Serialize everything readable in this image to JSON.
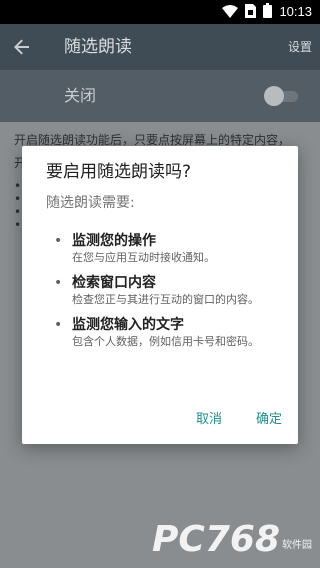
{
  "status_bar": {
    "time": "10:13",
    "icons": [
      "wifi-icon",
      "sim-icon",
      "battery-icon"
    ]
  },
  "app_bar": {
    "title": "随选朗读",
    "settings_label": "设置",
    "back_icon": "arrow-back-icon"
  },
  "switch_bar": {
    "label": "关闭",
    "enabled": false
  },
  "content": {
    "para1": "开启随选朗读功能后，只要点按屏幕上的特定内容，",
    "para2": "开",
    "bullets": [
      "•",
      "•",
      "•",
      "•"
    ]
  },
  "dialog": {
    "title": "要启用随选朗读吗?",
    "subtitle": "随选朗读需要:",
    "permissions": [
      {
        "bullet": "•",
        "title": "监测您的操作",
        "desc": "在您与应用互动时接收通知。"
      },
      {
        "bullet": "•",
        "title": "检索窗口内容",
        "desc": "检查您正与其进行互动的窗口的内容。"
      },
      {
        "bullet": "•",
        "title": "监测您输入的文字",
        "desc": "包含个人数据，例如信用卡号和密码。"
      }
    ],
    "cancel_label": "取消",
    "ok_label": "确定"
  },
  "watermark": {
    "logo": "PC768",
    "site": "软件园"
  },
  "colors": {
    "accent": "#1f8f8c",
    "app_bar": "#3f4c55",
    "switch_bar": "#525d65",
    "scrim_content": "#8a8d8f"
  }
}
